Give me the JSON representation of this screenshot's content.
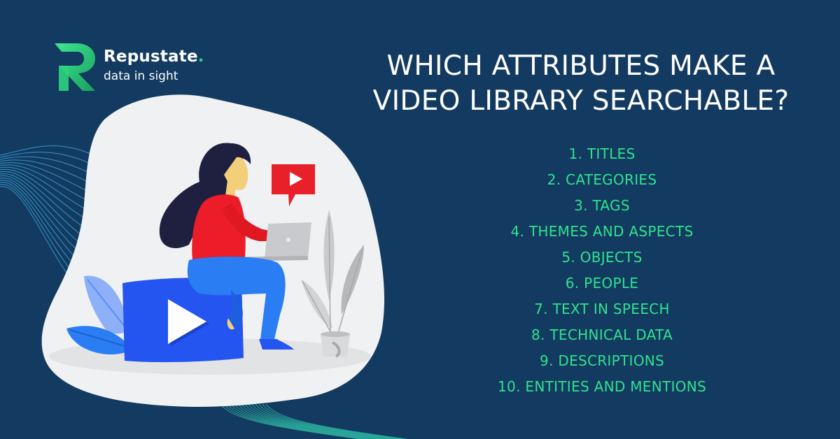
{
  "brand": {
    "name": "Repustate",
    "name_dot": ".",
    "tagline": "data in sight",
    "logo_icon": "repustate-r-logo",
    "colors": {
      "logo_green": "#2ed37f",
      "logo_dark_green": "#1aa160"
    }
  },
  "headline": {
    "line1": "WHICH ATTRIBUTES MAKE A",
    "line2": "VIDEO LIBRARY SEARCHABLE?"
  },
  "attributes": [
    {
      "label": "1. TITLES"
    },
    {
      "label": "2. CATEGORIES"
    },
    {
      "label": "3. TAGS"
    },
    {
      "label": "4. THEMES AND ASPECTS"
    },
    {
      "label": "5. OBJECTS"
    },
    {
      "label": "6. PEOPLE"
    },
    {
      "label": "7. TEXT IN SPEECH"
    },
    {
      "label": "8. TECHNICAL DATA"
    },
    {
      "label": "9. DESCRIPTIONS"
    },
    {
      "label": "10. ENTITIES AND MENTIONS"
    }
  ],
  "illustration": {
    "subject": "woman-with-laptop-sitting-on-video-play-block",
    "icons": [
      "video-play-block-icon",
      "video-speech-bubble-icon",
      "laptop-icon",
      "plant-icon",
      "leaf-icon"
    ]
  },
  "colors": {
    "background": "#133a60",
    "headline_text": "#ffffff",
    "list_text": "#2ee38e",
    "blob": "#f0f1f2",
    "play_blue": "#2455f0",
    "bubble_red": "#e8202a",
    "shirt_red": "#ec1c28",
    "jeans_blue": "#2a7df2",
    "hair": "#1f2040",
    "skin": "#f3cf7a",
    "wave_lines": "#3aa7d9"
  }
}
